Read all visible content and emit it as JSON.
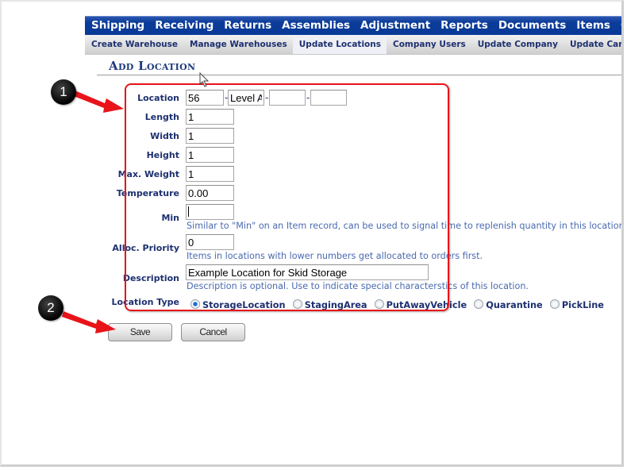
{
  "top_nav": [
    "Shipping",
    "Receiving",
    "Returns",
    "Assemblies",
    "Adjustment",
    "Reports",
    "Documents",
    "Items",
    "Customers"
  ],
  "sub_nav": [
    {
      "label": "Create Warehouse",
      "active": false
    },
    {
      "label": "Manage Warehouses",
      "active": false
    },
    {
      "label": "Update Locations",
      "active": true
    },
    {
      "label": "Company Users",
      "active": false
    },
    {
      "label": "Update Company",
      "active": false
    },
    {
      "label": "Update Carriers",
      "active": false
    }
  ],
  "page_title": "Add Location",
  "form": {
    "location": {
      "label": "Location",
      "parts": [
        "56",
        "Level A",
        "",
        ""
      ],
      "separator": "-"
    },
    "length": {
      "label": "Length",
      "value": "1"
    },
    "width": {
      "label": "Width",
      "value": "1"
    },
    "height": {
      "label": "Height",
      "value": "1"
    },
    "max_weight": {
      "label": "Max. Weight",
      "value": "1"
    },
    "temperature": {
      "label": "Temperature",
      "value": "0.00"
    },
    "min": {
      "label": "Min",
      "value": "",
      "hint": "Similar to \"Min\" on an Item record, can be used to signal time to replenish quantity in this location"
    },
    "alloc_priority": {
      "label": "Alloc. Priority",
      "value": "0",
      "hint": "Items in locations with lower numbers get allocated to orders first."
    },
    "description": {
      "label": "Description",
      "value": "Example Location for Skid Storage",
      "hint": "Description is optional. Use to indicate special characterstics of this location."
    },
    "location_type": {
      "label": "Location Type",
      "options": [
        "StorageLocation",
        "StagingArea",
        "PutAwayVehicle",
        "Quarantine",
        "PickLine"
      ],
      "selected": "StorageLocation"
    }
  },
  "buttons": {
    "save": "Save",
    "cancel": "Cancel"
  },
  "annotations": {
    "callout_1": "1",
    "callout_2": "2",
    "highlight_color": "#e8141a"
  },
  "colors": {
    "nav_blue": "#0c3c9a",
    "label_navy": "#1d3070",
    "hint_blue": "#4a6ab0"
  }
}
